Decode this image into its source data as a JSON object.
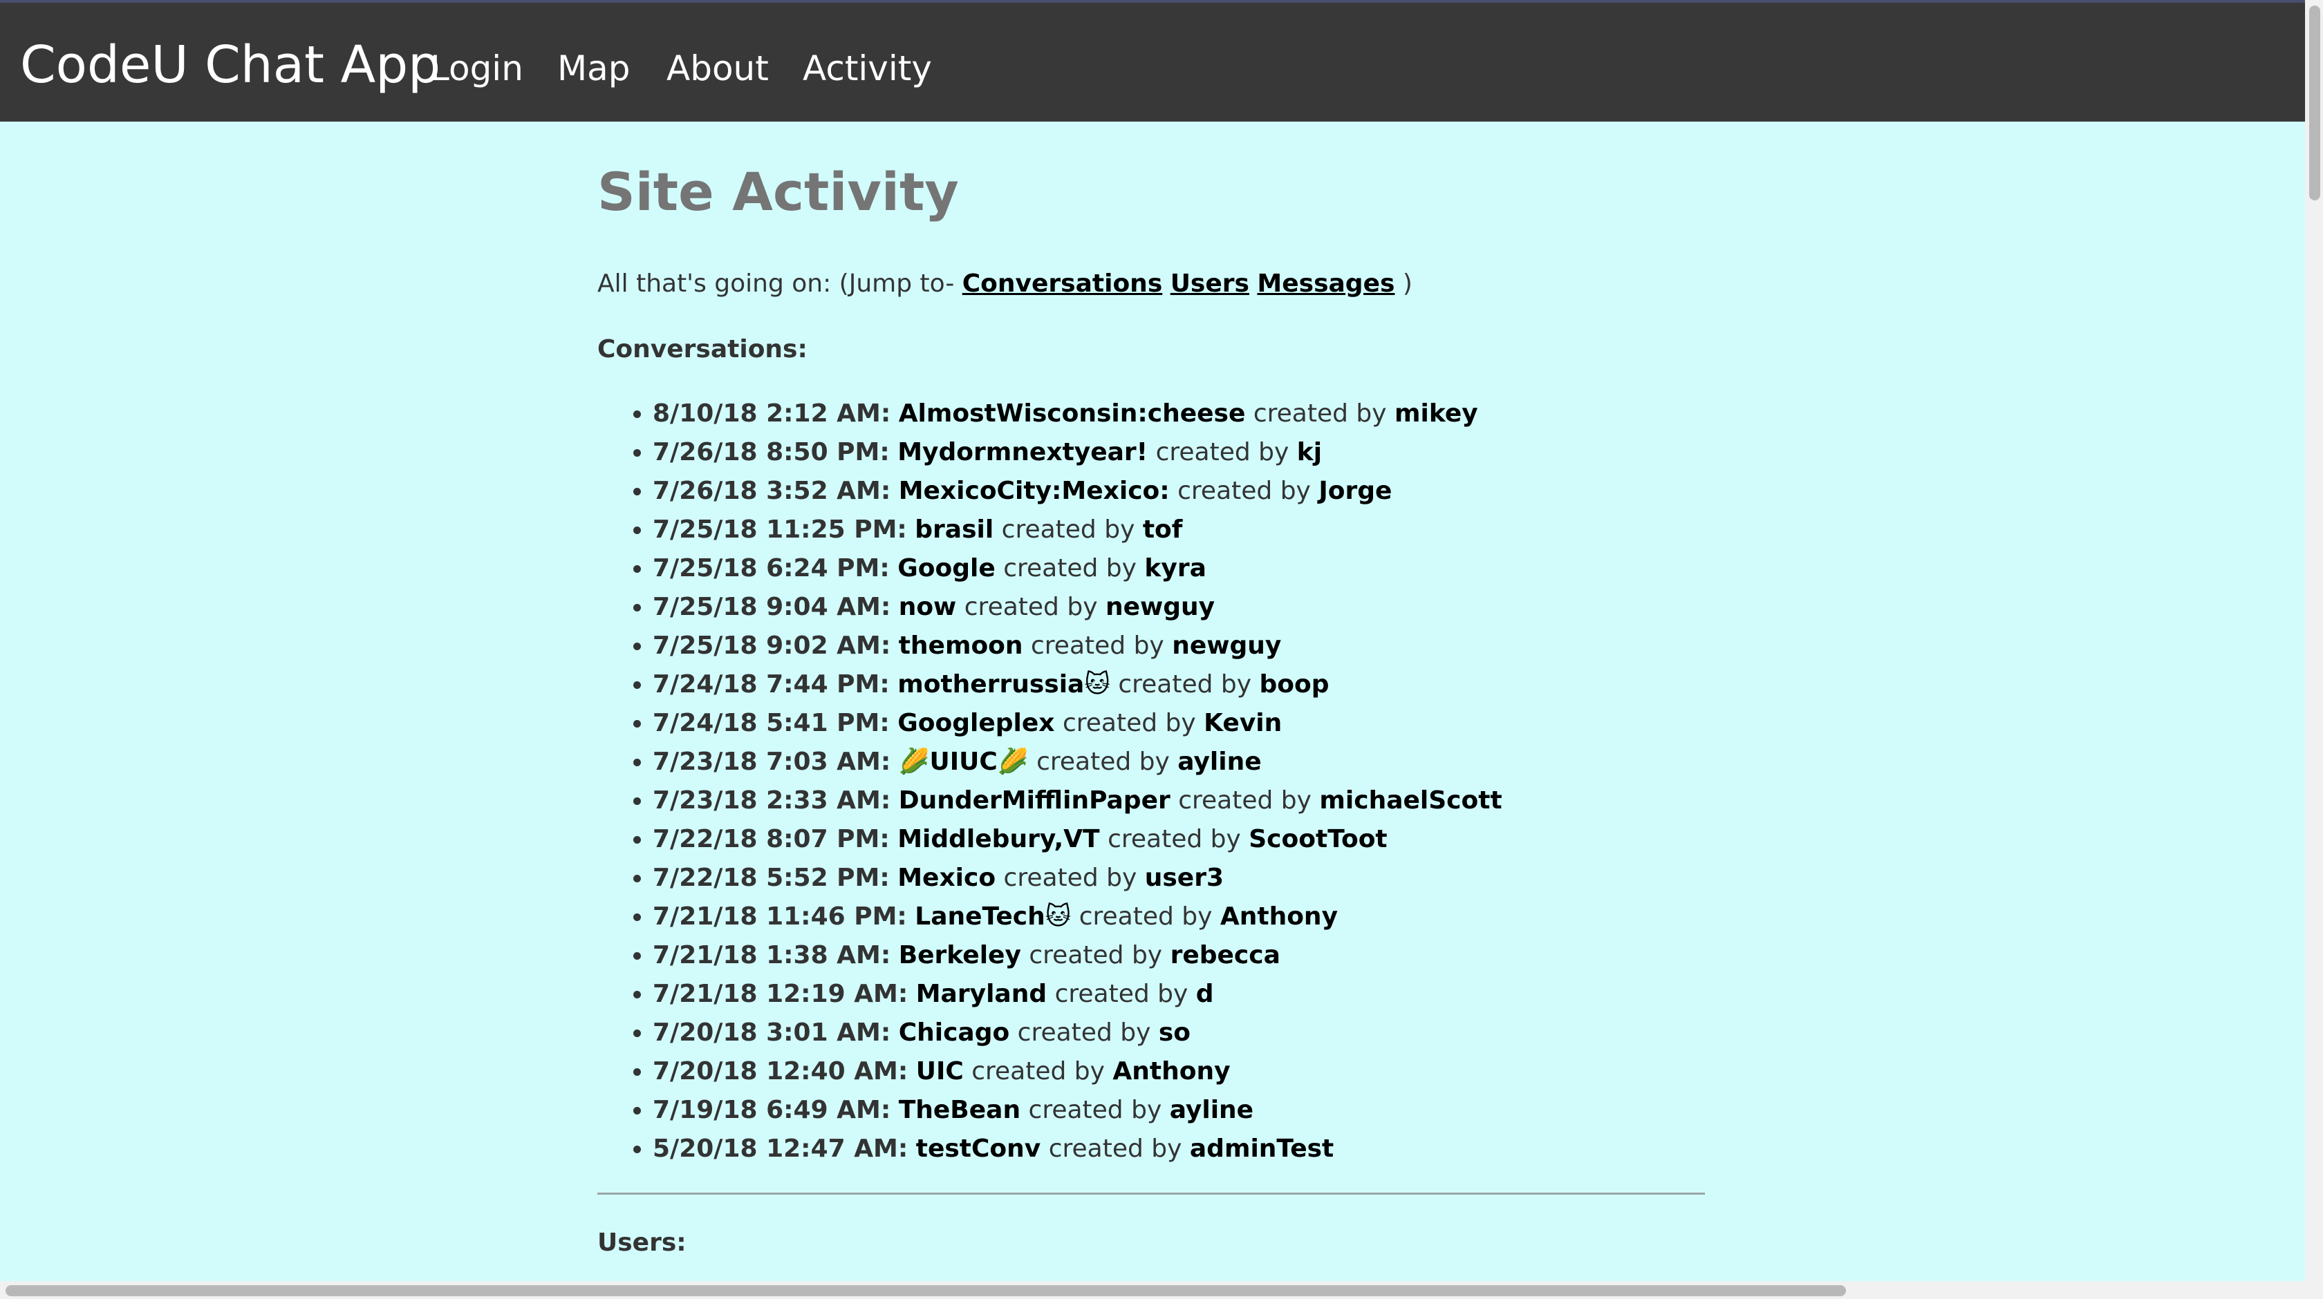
{
  "nav": {
    "brand": "CodeU Chat App",
    "links": [
      "Login",
      "Map",
      "About",
      "Activity"
    ]
  },
  "page": {
    "title": "Site Activity",
    "intro_prefix": "All that's going on: (Jump to- ",
    "jump_links": [
      "Conversations",
      "Users",
      "Messages"
    ],
    "intro_suffix": " )",
    "conversations_label": "Conversations:",
    "users_label": "Users:",
    "created_by_text": "created by"
  },
  "conversations": [
    {
      "time": "8/10/18 2:12 AM:",
      "title": "AlmostWisconsin:cheese",
      "author": "mikey"
    },
    {
      "time": "7/26/18 8:50 PM:",
      "title": "Mydormnextyear!",
      "author": "kj"
    },
    {
      "time": "7/26/18 3:52 AM:",
      "title": "MexicoCity:Mexico:",
      "author": "Jorge"
    },
    {
      "time": "7/25/18 11:25 PM:",
      "title": "brasil",
      "author": "tof"
    },
    {
      "time": "7/25/18 6:24 PM:",
      "title": "Google",
      "author": "kyra"
    },
    {
      "time": "7/25/18 9:04 AM:",
      "title": "now",
      "author": "newguy"
    },
    {
      "time": "7/25/18 9:02 AM:",
      "title": "themoon",
      "author": "newguy"
    },
    {
      "time": "7/24/18 7:44 PM:",
      "title": "motherrussia🐱",
      "author": "boop"
    },
    {
      "time": "7/24/18 5:41 PM:",
      "title": "Googleplex",
      "author": "Kevin"
    },
    {
      "time": "7/23/18 7:03 AM:",
      "title": "🌽UIUC🌽",
      "author": "ayline"
    },
    {
      "time": "7/23/18 2:33 AM:",
      "title": "DunderMifflinPaper",
      "author": "michaelScott"
    },
    {
      "time": "7/22/18 8:07 PM:",
      "title": "Middlebury,VT",
      "author": "ScootToot"
    },
    {
      "time": "7/22/18 5:52 PM:",
      "title": "Mexico",
      "author": "user3"
    },
    {
      "time": "7/21/18 11:46 PM:",
      "title": "LaneTech🐱",
      "author": "Anthony"
    },
    {
      "time": "7/21/18 1:38 AM:",
      "title": "Berkeley",
      "author": "rebecca"
    },
    {
      "time": "7/21/18 12:19 AM:",
      "title": "Maryland",
      "author": "d"
    },
    {
      "time": "7/20/18 3:01 AM:",
      "title": "Chicago",
      "author": "so"
    },
    {
      "time": "7/20/18 12:40 AM:",
      "title": "UIC",
      "author": "Anthony"
    },
    {
      "time": "7/19/18 6:49 AM:",
      "title": "TheBean",
      "author": "ayline"
    },
    {
      "time": "5/20/18 12:47 AM:",
      "title": "testConv",
      "author": "adminTest"
    }
  ]
}
